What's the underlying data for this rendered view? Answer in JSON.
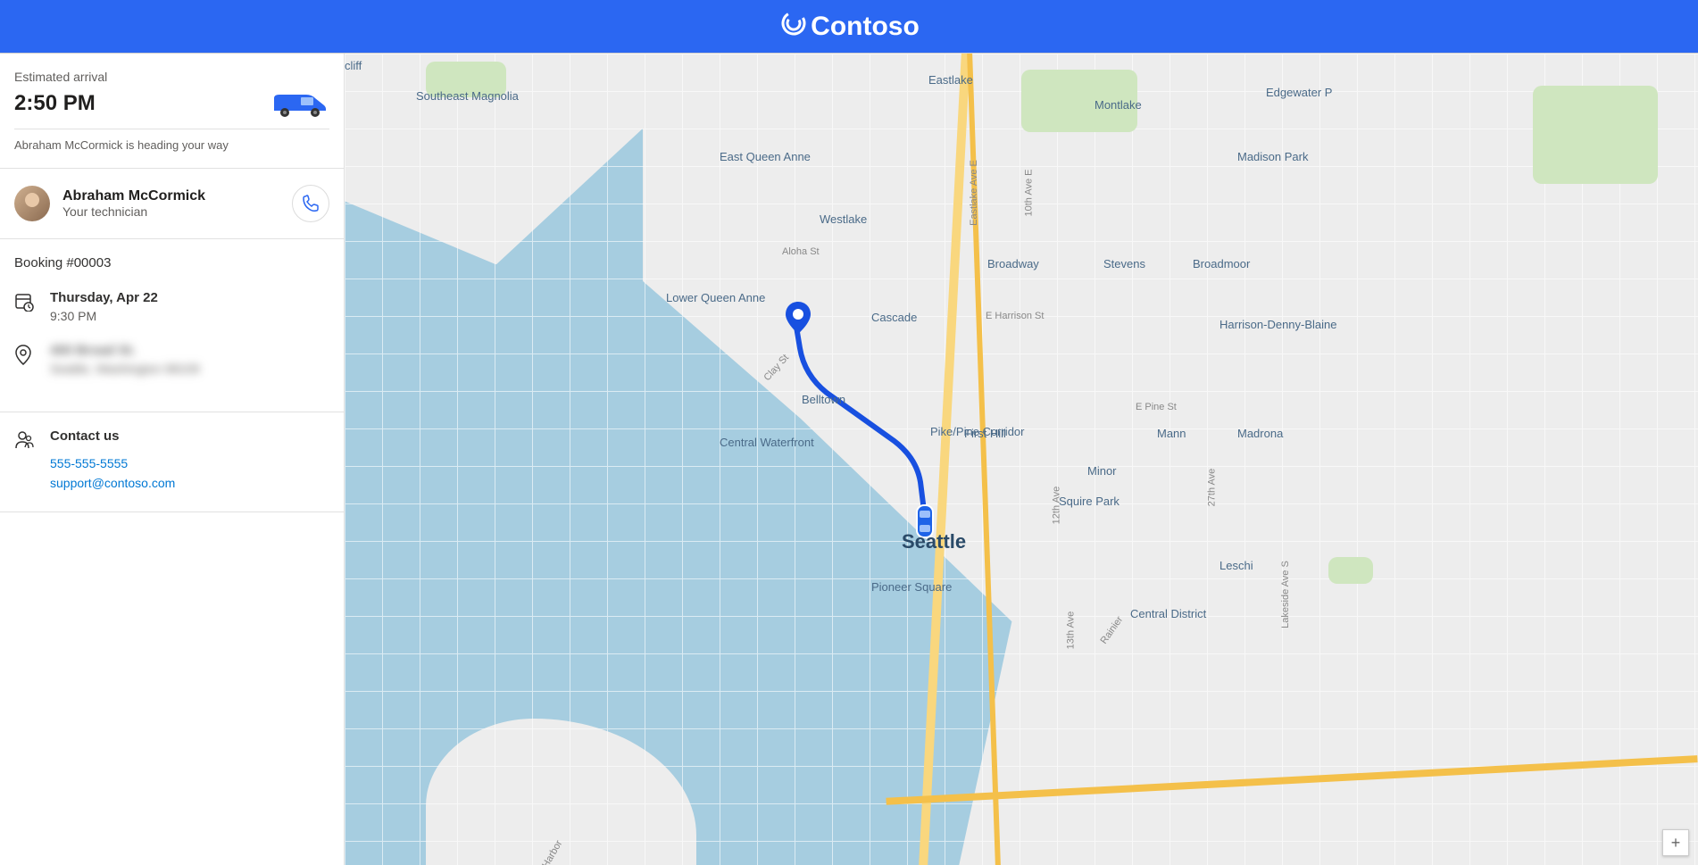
{
  "brand": {
    "name": "Contoso"
  },
  "eta": {
    "label": "Estimated arrival",
    "time": "2:50 PM",
    "status": "Abraham McCormick is heading your way"
  },
  "technician": {
    "name": "Abraham McCormick",
    "role": "Your technician"
  },
  "booking": {
    "id_label": "Booking #00003",
    "date": "Thursday, Apr 22",
    "time": "9:30 PM",
    "address_line1": "400 Broad St.",
    "address_line2": "Seattle, Washington 98109"
  },
  "contact": {
    "heading": "Contact us",
    "phone": "555-555-5555",
    "email": "support@contoso.com"
  },
  "map": {
    "city": "Seattle",
    "zoom_in": "+",
    "labels": {
      "southeast_magnolia": "Southeast Magnolia",
      "east_queen_anne": "East Queen Anne",
      "lower_queen_anne": "Lower Queen Anne",
      "westlake": "Westlake",
      "cascade": "Cascade",
      "belltown": "Belltown",
      "central_waterfront": "Central Waterfront",
      "pike_pine": "Pike/Pine Corridor",
      "first_hill": "First Hill",
      "pioneer_square": "Pioneer Square",
      "broadway": "Broadway",
      "stevens": "Stevens",
      "eastlake": "Eastlake",
      "montlake": "Montlake",
      "edgewater": "Edgewater P",
      "madison_park": "Madison Park",
      "broadmoor": "Broadmoor",
      "harrison_denny": "Harrison-Denny-Blaine",
      "minor": "Minor",
      "mann": "Mann",
      "madrona": "Madrona",
      "squire_park": "Squire Park",
      "leschi": "Leschi",
      "central_district": "Central District",
      "cliff": "cliff",
      "aloha_st": "Aloha St",
      "e_harrison_st": "E Harrison St",
      "e_pine_st": "E Pine St",
      "clay_st": "Clay St",
      "harbor": "Harbor",
      "eastlake_ave": "Eastlake Ave E",
      "tenth_ave": "10th Ave E",
      "twelfth_ave": "12th Ave",
      "thirteenth_ave": "13th Ave",
      "twentyseventh_ave": "27th Ave",
      "lakeside_ave": "Lakeside Ave S",
      "rainier": "Rainier"
    }
  }
}
